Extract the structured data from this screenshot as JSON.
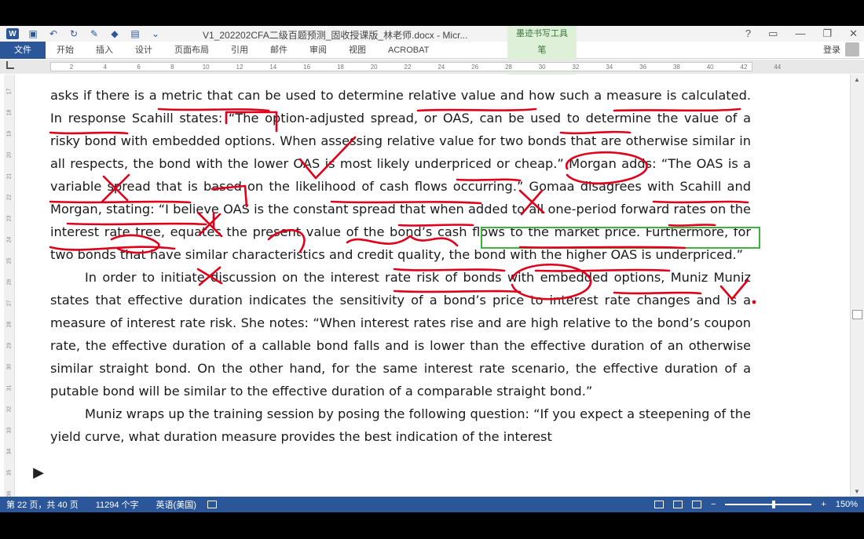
{
  "window": {
    "title": "V1_202202CFA二级百题预测_固收授课版_林老师.docx - Micr...",
    "ink_tools_label": "墨迹书写工具",
    "help": "?",
    "minimize": "—",
    "restore": "❐",
    "close": "✕"
  },
  "ribbon": {
    "tabs": [
      "文件",
      "开始",
      "插入",
      "设计",
      "页面布局",
      "引用",
      "邮件",
      "审阅",
      "视图",
      "ACROBAT"
    ],
    "ink_tab": "笔",
    "login": "登录"
  },
  "ruler": {
    "ticks": [
      "2",
      "4",
      "6",
      "8",
      "10",
      "12",
      "14",
      "16",
      "18",
      "20",
      "22",
      "24",
      "26",
      "28",
      "30",
      "32",
      "34",
      "36",
      "38",
      "40",
      "42",
      "44"
    ]
  },
  "vruler": {
    "ticks": [
      "17",
      "18",
      "19",
      "20",
      "21",
      "22",
      "23",
      "24",
      "25",
      "26",
      "27",
      "28",
      "29",
      "30",
      "31",
      "32",
      "33",
      "34",
      "35",
      "36"
    ]
  },
  "document": {
    "paragraphs": [
      "asks if there is a metric that can be used to determine relative value and how such a measure is calculated. In response Scahill states: “The option-adjusted spread, or OAS, can be used to determine the value of a risky bond with embedded options. When assessing relative value for two bonds that are otherwise similar in all respects, the bond with the lower OAS is most likely underpriced or cheap.” Morgan adds: “The OAS is a variable spread that is based on the likelihood of cash flows occurring.” Gomaa disagrees with Scahill and Morgan, stating: “I believe OAS is the constant spread that when added to all one-period forward rates on the interest rate tree, equates the present value of the bond’s cash flows to the market price. Furthermore, for two bonds that have similar characteristics and credit quality, the bond with the higher OAS is underpriced.”",
      "In order to initiate discussion on the interest rate risk of bonds with embedded options, Muniz Muniz states that effective duration indicates the sensitivity of a bond’s price to interest rate changes and is a measure of interest rate risk. She notes: “When interest rates rise and are high relative to the bond’s coupon rate, the effective duration of a callable bond falls and is lower than the effective duration of an otherwise similar straight bond. On the other hand, for the same interest rate scenario, the effective duration of a putable bond will be similar to the effective duration of a comparable straight bond.”",
      "Muniz wraps up the training session by posing the following question: “If you expect a steepening of the yield curve, what duration measure provides the best indication of the interest"
    ]
  },
  "status_bar": {
    "page": "第 22 页，共 40 页",
    "words": "11294 个字",
    "language": "英语(美国)",
    "zoom_minus": "−",
    "zoom_plus": "+",
    "zoom": "150%"
  },
  "player": {
    "play_icon": "▶"
  },
  "colors": {
    "brand": "#2b579a",
    "ink": "#e0001b",
    "highlight_box": "#3cb43c",
    "ink_tab_bg": "#dff0d8"
  }
}
